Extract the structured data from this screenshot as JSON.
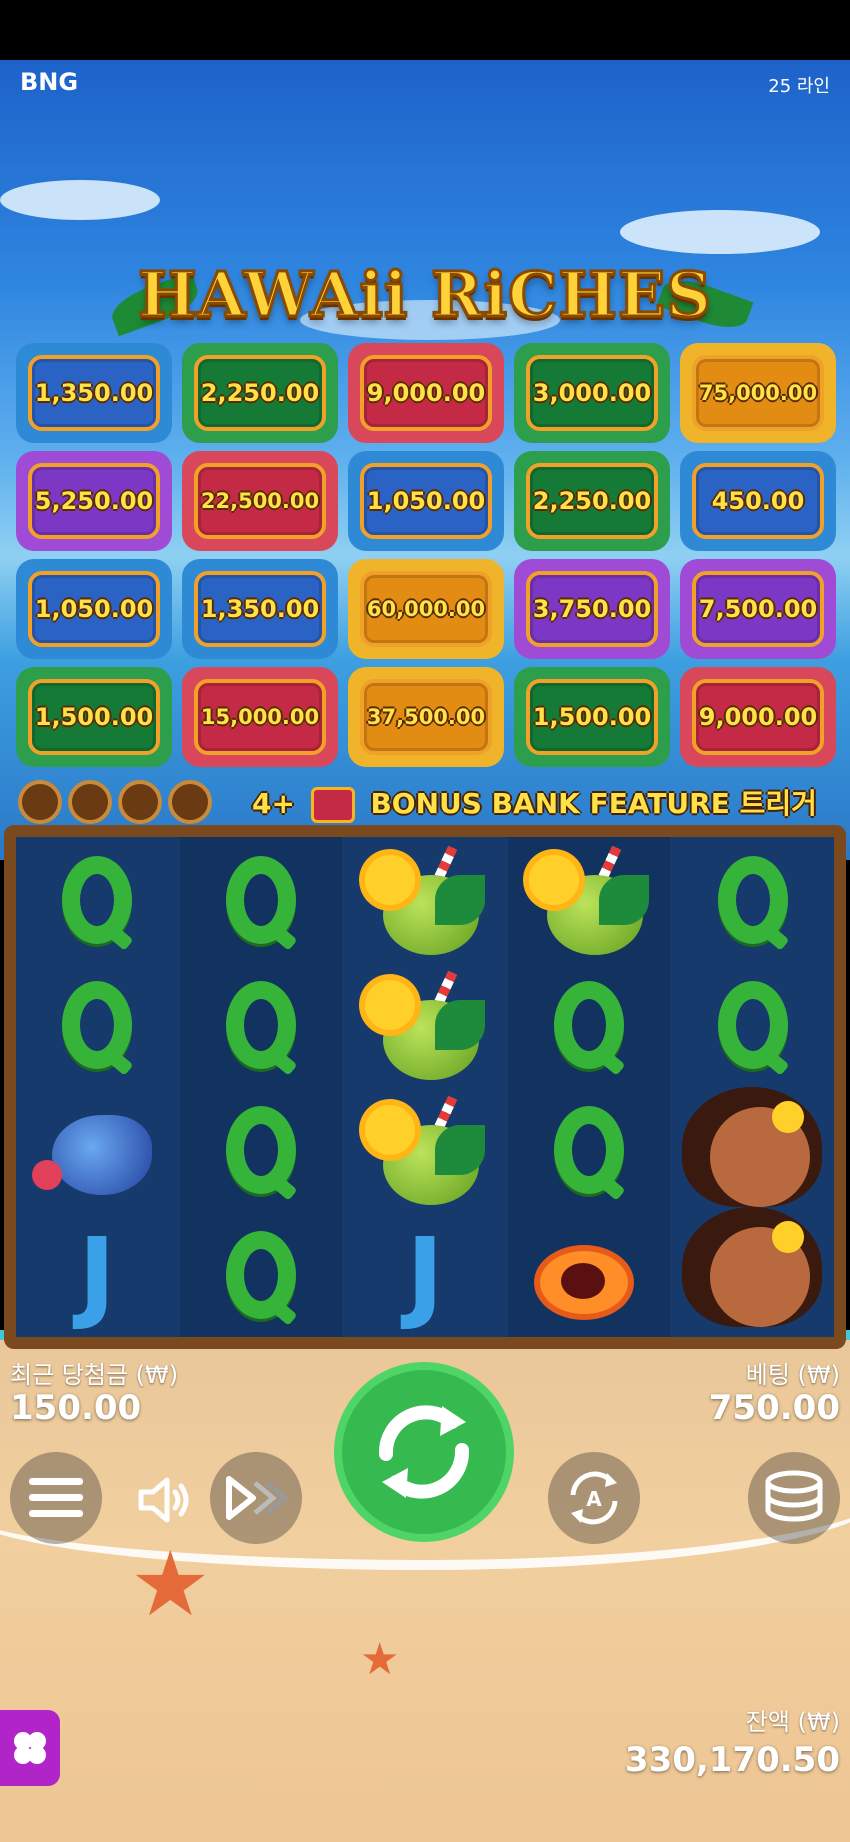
{
  "header": {
    "brand": "BNG",
    "lines_label": "25 라인"
  },
  "game": {
    "title": "HAWAii RiCHES"
  },
  "prize_grid": [
    [
      {
        "value": "1,350.00",
        "color": "blue"
      },
      {
        "value": "2,250.00",
        "color": "green"
      },
      {
        "value": "9,000.00",
        "color": "red"
      },
      {
        "value": "3,000.00",
        "color": "green"
      },
      {
        "value": "75,000.00",
        "color": "gold"
      }
    ],
    [
      {
        "value": "5,250.00",
        "color": "purple"
      },
      {
        "value": "22,500.00",
        "color": "red"
      },
      {
        "value": "1,050.00",
        "color": "blue"
      },
      {
        "value": "2,250.00",
        "color": "green"
      },
      {
        "value": "450.00",
        "color": "blue"
      }
    ],
    [
      {
        "value": "1,050.00",
        "color": "blue"
      },
      {
        "value": "1,350.00",
        "color": "blue"
      },
      {
        "value": "60,000.00",
        "color": "gold"
      },
      {
        "value": "3,750.00",
        "color": "purple"
      },
      {
        "value": "7,500.00",
        "color": "purple"
      }
    ],
    [
      {
        "value": "1,500.00",
        "color": "green"
      },
      {
        "value": "15,000.00",
        "color": "red"
      },
      {
        "value": "37,500.00",
        "color": "gold"
      },
      {
        "value": "1,500.00",
        "color": "green"
      },
      {
        "value": "9,000.00",
        "color": "red"
      }
    ]
  ],
  "bonus": {
    "prefix": "4+",
    "badge_text": "BONUS BANK",
    "feature_text": "BONUS BANK FEATURE 트리거"
  },
  "reels": [
    [
      "Q-icon",
      "Q-icon",
      "shell-icon",
      "J-icon"
    ],
    [
      "Q-icon",
      "Q-icon",
      "Q-icon",
      "Q-icon"
    ],
    [
      "cocktail-icon",
      "cocktail-icon",
      "cocktail-icon",
      "J-icon"
    ],
    [
      "cocktail-icon",
      "Q-icon",
      "Q-icon",
      "papaya-icon"
    ],
    [
      "Q-icon",
      "Q-icon",
      "hula-girl-icon",
      "hula-girl-icon"
    ]
  ],
  "footer": {
    "last_win_label": "최근 당첨금 (₩)",
    "last_win_value": "150.00",
    "bet_label": "베팅 (₩)",
    "bet_value": "750.00",
    "balance_label": "잔액 (₩)",
    "balance_value": "330,170.50"
  },
  "colors": {
    "accent_green": "#36b94f",
    "prize_text": "#ffe24a",
    "frame_orange": "#f1a128"
  }
}
